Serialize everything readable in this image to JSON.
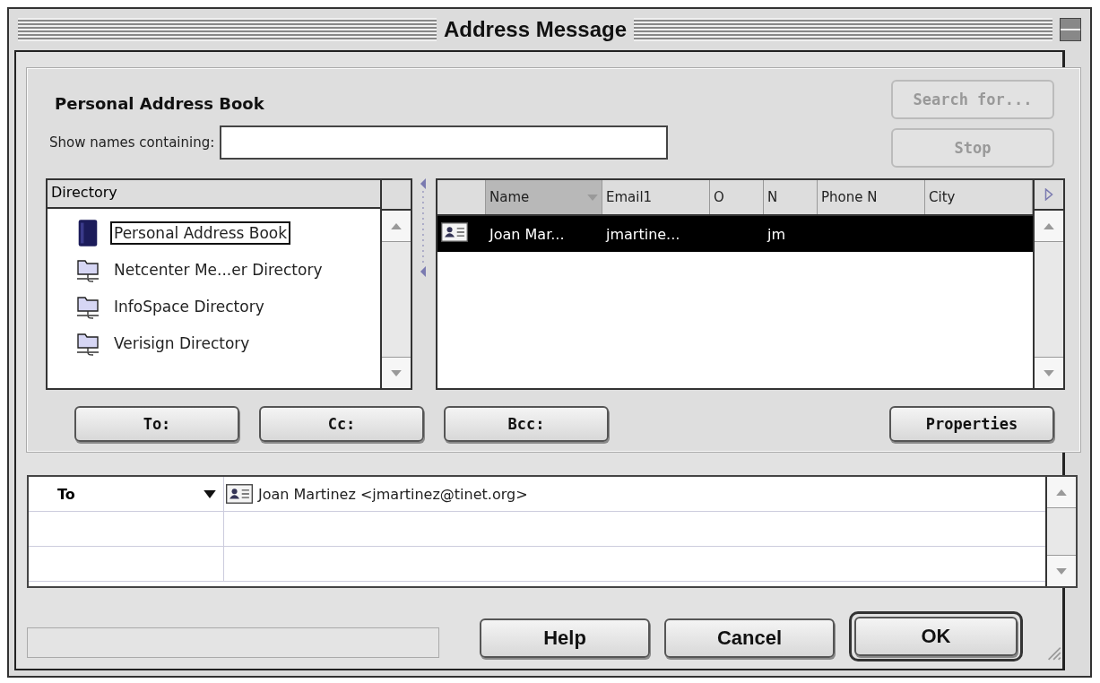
{
  "window": {
    "title": "Address Message"
  },
  "address_book": {
    "heading": "Personal Address Book",
    "filter_label": "Show names containing:"
  },
  "side_buttons": [
    {
      "label": "Search for...",
      "disabled": true
    },
    {
      "label": "Stop",
      "disabled": true
    }
  ],
  "directory": {
    "heading": "Directory",
    "items": [
      {
        "kind": "book",
        "label": "Personal Address Book",
        "selected": true
      },
      {
        "kind": "server",
        "label": "Netcenter Me...er Directory",
        "selected": false
      },
      {
        "kind": "server",
        "label": "InfoSpace Directory",
        "selected": false
      },
      {
        "kind": "server",
        "label": "Verisign Directory",
        "selected": false
      }
    ]
  },
  "results": {
    "columns": [
      {
        "label": "Name",
        "sorted": true
      },
      {
        "label": "Email1",
        "sorted": false
      },
      {
        "label": "O",
        "sorted": false
      },
      {
        "label": "N",
        "sorted": false
      },
      {
        "label": "Phone N",
        "sorted": false
      },
      {
        "label": "City",
        "sorted": false
      }
    ],
    "rows": [
      {
        "name": "Joan Mar...",
        "email1": "jmartine...",
        "n": "jm",
        "selected": true
      }
    ]
  },
  "add_buttons": [
    {
      "label": "To:"
    },
    {
      "label": "Cc:"
    },
    {
      "label": "Bcc:"
    }
  ],
  "properties_button": {
    "label": "Properties"
  },
  "recipients": [
    {
      "type": "To",
      "address": "Joan Martinez <jmartinez@tinet.org>"
    }
  ],
  "buttons": [
    {
      "label": "Help",
      "default": false
    },
    {
      "label": "Cancel",
      "default": false
    },
    {
      "label": "OK",
      "default": true
    }
  ]
}
